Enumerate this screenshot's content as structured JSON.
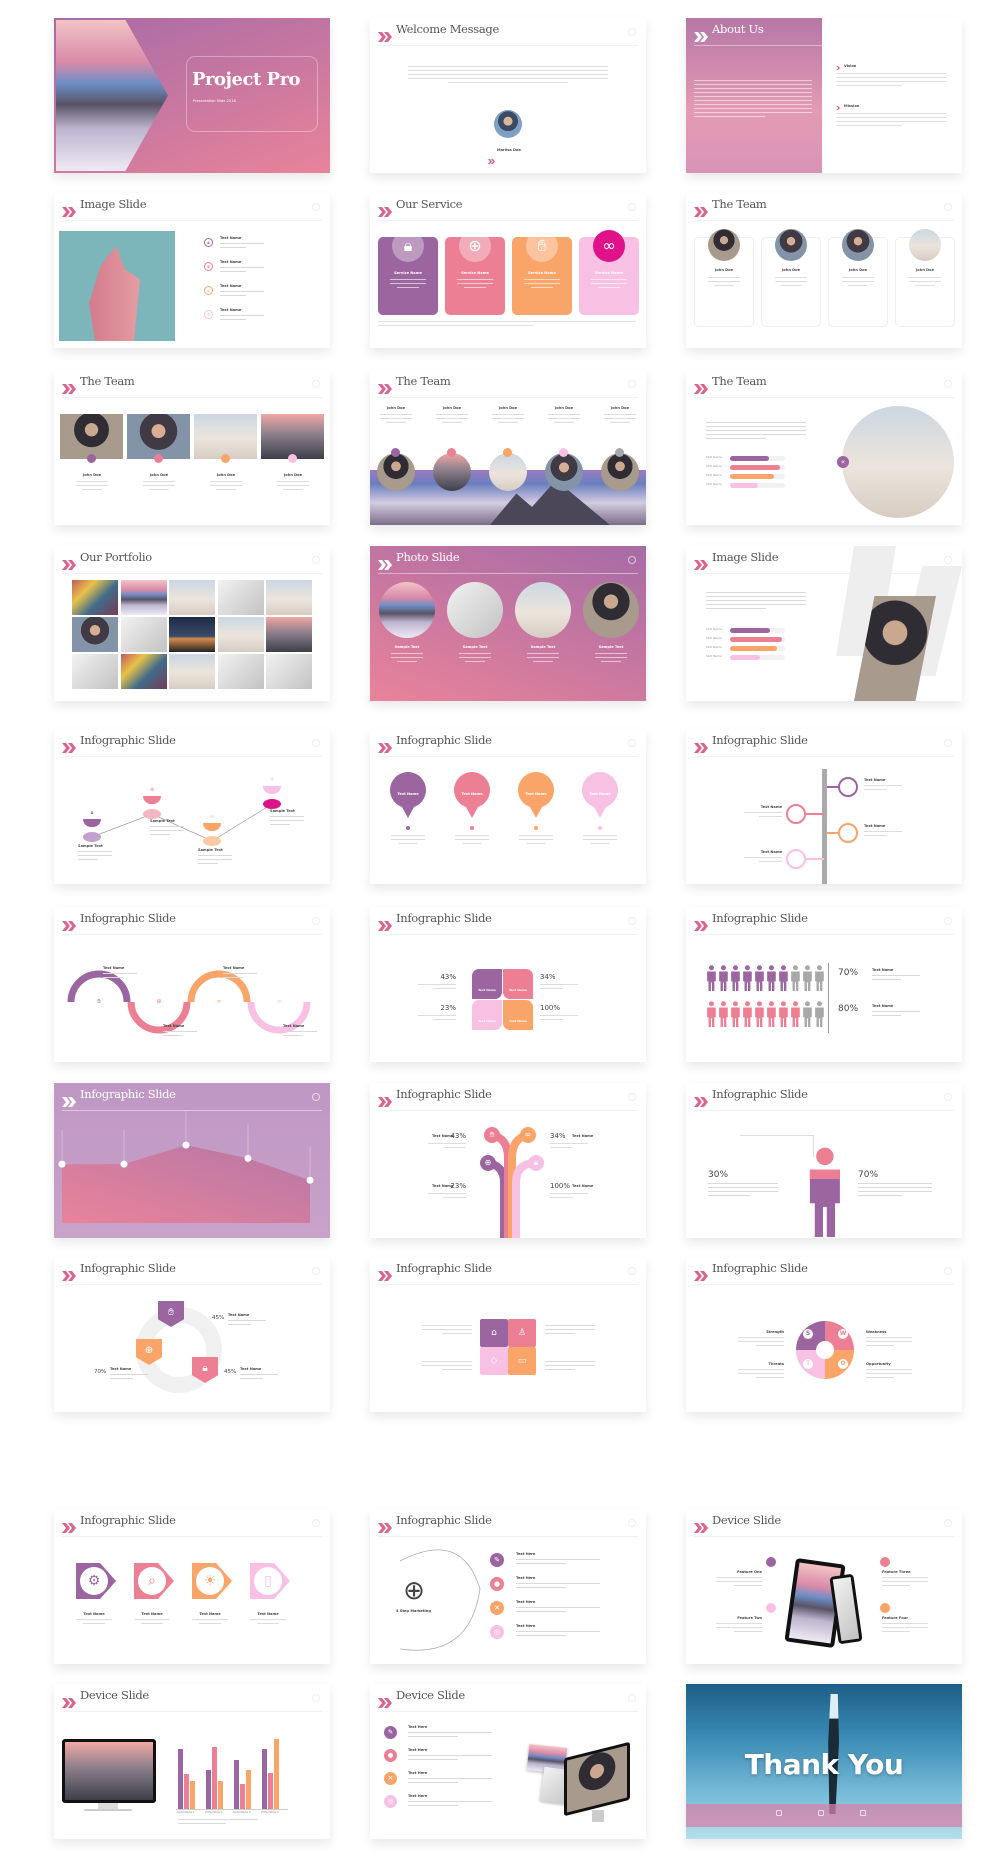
{
  "palette": {
    "accent": "#d9668f",
    "purple": "#9b65a0",
    "pink": "#ec7f93",
    "orange": "#f9a56a",
    "light_pink": "#f8c1e3",
    "magenta": "#e0128a",
    "gray": "#a8a8a8"
  },
  "slides": [
    {
      "type": "cover",
      "title": "Project Pro",
      "subtitle": "Presentation Slide 2018"
    },
    {
      "type": "welcome",
      "title": "Welcome Message",
      "author": "Marlisa Doe"
    },
    {
      "type": "about",
      "title": "About Us",
      "items": [
        {
          "label": "Vision"
        },
        {
          "label": "Mission"
        }
      ]
    },
    {
      "type": "image-list",
      "title": "Image Slide",
      "items": [
        {
          "label": "Text Name",
          "icon": "lock-icon"
        },
        {
          "label": "Text Name",
          "icon": "globe-icon"
        },
        {
          "label": "Text Name",
          "icon": "link-icon"
        },
        {
          "label": "Text Name",
          "icon": "hand-icon"
        }
      ]
    },
    {
      "type": "service",
      "title": "Our Service",
      "cards": [
        {
          "label": "Service Name",
          "icon": "lock-icon"
        },
        {
          "label": "Service Name",
          "icon": "globe-icon"
        },
        {
          "label": "Service Name",
          "icon": "hand-icon"
        },
        {
          "label": "Service Name",
          "icon": "link-icon"
        }
      ]
    },
    {
      "type": "team-cards",
      "title": "The Team",
      "members": [
        {
          "name": "John Doe"
        },
        {
          "name": "John Doe"
        },
        {
          "name": "John Doe"
        },
        {
          "name": "John Doe"
        }
      ]
    },
    {
      "type": "team-photos",
      "title": "The Team",
      "members": [
        {
          "name": "John Doe"
        },
        {
          "name": "John Doe"
        },
        {
          "name": "John Doe"
        },
        {
          "name": "John Doe"
        }
      ]
    },
    {
      "type": "team-mountain",
      "title": "The Team",
      "members": [
        {
          "name": "John Doe"
        },
        {
          "name": "John Doe"
        },
        {
          "name": "John Doe"
        },
        {
          "name": "John Doe"
        },
        {
          "name": "John Doe"
        }
      ]
    },
    {
      "type": "team-skills",
      "title": "The Team",
      "skills": [
        {
          "label": "Skill Name",
          "value": 0.7
        },
        {
          "label": "Skill Name",
          "value": 0.9
        },
        {
          "label": "Skill Name",
          "value": 0.8
        },
        {
          "label": "Skill Name",
          "value": 0.5
        }
      ]
    },
    {
      "type": "portfolio",
      "title": "Our Portfolio"
    },
    {
      "type": "photo",
      "title": "Photo Slide",
      "items": [
        {
          "label": "Sample Text"
        },
        {
          "label": "Sample Text"
        },
        {
          "label": "Sample Text"
        },
        {
          "label": "Sample Text"
        }
      ]
    },
    {
      "type": "image-skills",
      "title": "Image Slide",
      "skills": [
        {
          "label": "Skill Name",
          "value": 0.72
        },
        {
          "label": "Skill Name",
          "value": 0.95
        },
        {
          "label": "Skill Name",
          "value": 0.85
        },
        {
          "label": "Skill Name",
          "value": 0.55
        }
      ]
    },
    {
      "type": "zigzag",
      "title": "Infographic Slide",
      "items": [
        {
          "label": "Sample Text"
        },
        {
          "label": "Sample Text"
        },
        {
          "label": "Sample Text"
        },
        {
          "label": "Sample Text"
        }
      ]
    },
    {
      "type": "pins",
      "title": "Infographic Slide",
      "items": [
        {
          "label": "Text Name"
        },
        {
          "label": "Text Name"
        },
        {
          "label": "Text Name"
        },
        {
          "label": "Text Name"
        }
      ]
    },
    {
      "type": "timeline",
      "title": "Infographic Slide",
      "items": [
        {
          "label": "Text Name"
        },
        {
          "label": "Text Name"
        },
        {
          "label": "Text Name"
        },
        {
          "label": "Text Name"
        }
      ]
    },
    {
      "type": "wave",
      "title": "Infographic Slide",
      "items": [
        {
          "label": "Text Name"
        },
        {
          "label": "Text Name"
        },
        {
          "label": "Text Name"
        },
        {
          "label": "Text Name"
        }
      ]
    },
    {
      "type": "quad",
      "title": "Infographic Slide",
      "stats": [
        {
          "value": "43%"
        },
        {
          "value": "34%"
        },
        {
          "value": "23%"
        },
        {
          "value": "100%"
        }
      ],
      "tiles": [
        {
          "label": "Text Name"
        },
        {
          "label": "Text Name"
        },
        {
          "label": "Text Name"
        },
        {
          "label": "Text Name"
        }
      ]
    },
    {
      "type": "people",
      "title": "Infographic Slide",
      "stats": [
        {
          "value": "70%",
          "fraction": 0.7,
          "label": "Text Name"
        },
        {
          "value": "80%",
          "fraction": 0.8,
          "label": "Text Name"
        }
      ]
    },
    {
      "type": "area",
      "title": "Infographic Slide",
      "values": [
        0.62,
        0.62,
        0.82,
        0.68,
        0.45
      ]
    },
    {
      "type": "tree",
      "title": "Infographic Slide",
      "stats": [
        {
          "value": "43%",
          "label": "Text Name"
        },
        {
          "value": "34%",
          "label": "Text Name"
        },
        {
          "value": "23%",
          "label": "Text Name"
        },
        {
          "value": "100%",
          "label": "Text Name"
        }
      ]
    },
    {
      "type": "person",
      "title": "Infographic Slide",
      "stats": [
        {
          "value": "30%"
        },
        {
          "value": "70%"
        }
      ]
    },
    {
      "type": "cycle",
      "title": "Infographic Slide",
      "stats": [
        {
          "value": "45%",
          "label": "Text Name"
        },
        {
          "value": "45%",
          "label": "Text Name"
        },
        {
          "value": "70%",
          "label": "Text Name"
        }
      ]
    },
    {
      "type": "puzzle",
      "title": "Infographic Slide"
    },
    {
      "type": "swot",
      "title": "Infographic Slide",
      "letters": [
        "S",
        "W",
        "T",
        "O"
      ],
      "labels": [
        "Strength",
        "Weakness",
        "Threats",
        "Opportunity"
      ]
    },
    {
      "type": "arrows",
      "title": "Infographic Slide",
      "items": [
        {
          "label": "Text Name",
          "icon": "gears-icon"
        },
        {
          "label": "Text Name",
          "icon": "search-icon"
        },
        {
          "label": "Text Name",
          "icon": "bulb-icon"
        },
        {
          "label": "Text Name",
          "icon": "phone-icon"
        }
      ]
    },
    {
      "type": "steps",
      "title": "Infographic Slide",
      "center": "4 Step Marketing",
      "items": [
        {
          "label": "Text Here"
        },
        {
          "label": "Text Here"
        },
        {
          "label": "Text Here"
        },
        {
          "label": "Text Here"
        }
      ]
    },
    {
      "type": "phone",
      "title": "Device Slide",
      "features": [
        {
          "label": "Feature One"
        },
        {
          "label": "Feature Three"
        },
        {
          "label": "Feature Two"
        },
        {
          "label": "Feature Four"
        }
      ]
    },
    {
      "type": "monitor-chart",
      "title": "Device Slide",
      "categories": [
        "Data Name 1",
        "Data Name 2",
        "Data Name 3",
        "Data Name 4"
      ],
      "series": [
        {
          "color": "#9b65a0",
          "values": [
            4.3,
            2.8,
            3.5,
            4.3
          ]
        },
        {
          "color": "#ec7f93",
          "values": [
            2.5,
            4.4,
            1.8,
            2.6
          ]
        },
        {
          "color": "#f9a56a",
          "values": [
            2.0,
            2.0,
            2.8,
            5.0
          ]
        }
      ]
    },
    {
      "type": "icons-monitor",
      "title": "Device Slide",
      "items": [
        {
          "label": "Text Here"
        },
        {
          "label": "Text Here"
        },
        {
          "label": "Text Here"
        },
        {
          "label": "Text Here"
        }
      ]
    },
    {
      "type": "thanks",
      "title": "Thank You"
    }
  ]
}
